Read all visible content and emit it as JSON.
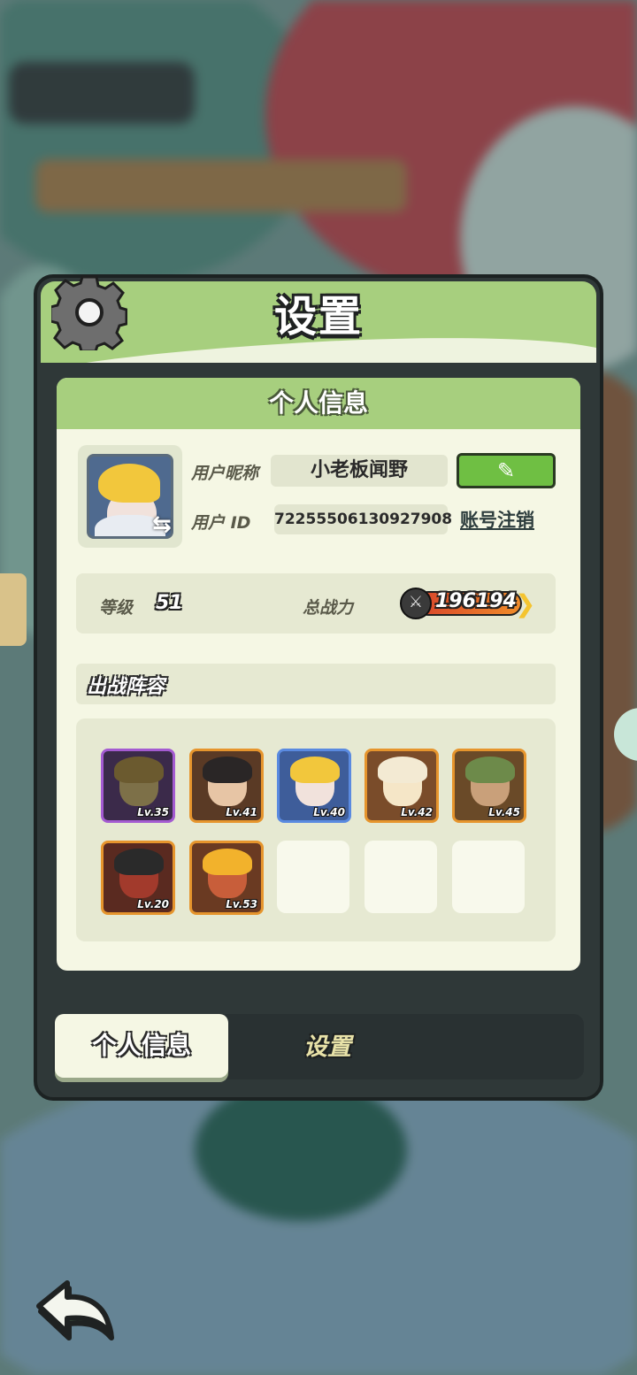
{
  "header": {
    "title": "设置"
  },
  "profile": {
    "section_title": "个人信息",
    "nickname_label": "用户昵称",
    "nickname": "小老板闻野",
    "uid_label": "用户 ID",
    "uid": "72255506130927908",
    "logout_label": "账号注销",
    "level_label": "等级",
    "level": "51",
    "power_label": "总战力",
    "power": "196194"
  },
  "lineup": {
    "title": "出战阵容",
    "heroes": [
      {
        "level": "Lv.35",
        "frame": "#a45bd1",
        "bg": "#3b2a4a",
        "hair": "#6b5a2f",
        "face": "#7d7048"
      },
      {
        "level": "Lv.41",
        "frame": "#e6952d",
        "bg": "#5a3a25",
        "hair": "#2a2626",
        "face": "#e7c5a5"
      },
      {
        "level": "Lv.40",
        "frame": "#5a8ae0",
        "bg": "#3e5d9a",
        "hair": "#f2c73c",
        "face": "#f1e2dc"
      },
      {
        "level": "Lv.42",
        "frame": "#e6952d",
        "bg": "#7a4c2a",
        "hair": "#f3ead3",
        "face": "#f5e6c7"
      },
      {
        "level": "Lv.45",
        "frame": "#e6952d",
        "bg": "#6a4a28",
        "hair": "#6d8a4a",
        "face": "#c9a07a"
      },
      {
        "level": "Lv.20",
        "frame": "#e6952d",
        "bg": "#5a2a20",
        "hair": "#2a2a2a",
        "face": "#a23a2c"
      },
      {
        "level": "Lv.53",
        "frame": "#e6952d",
        "bg": "#6a3a22",
        "hair": "#f2b22c",
        "face": "#c85e3a"
      }
    ]
  },
  "tabs": {
    "active": "个人信息",
    "other": "设置"
  },
  "colors": {
    "green": "#a7cf7e",
    "panel": "#2f3838",
    "cream": "#f5f7e4"
  }
}
